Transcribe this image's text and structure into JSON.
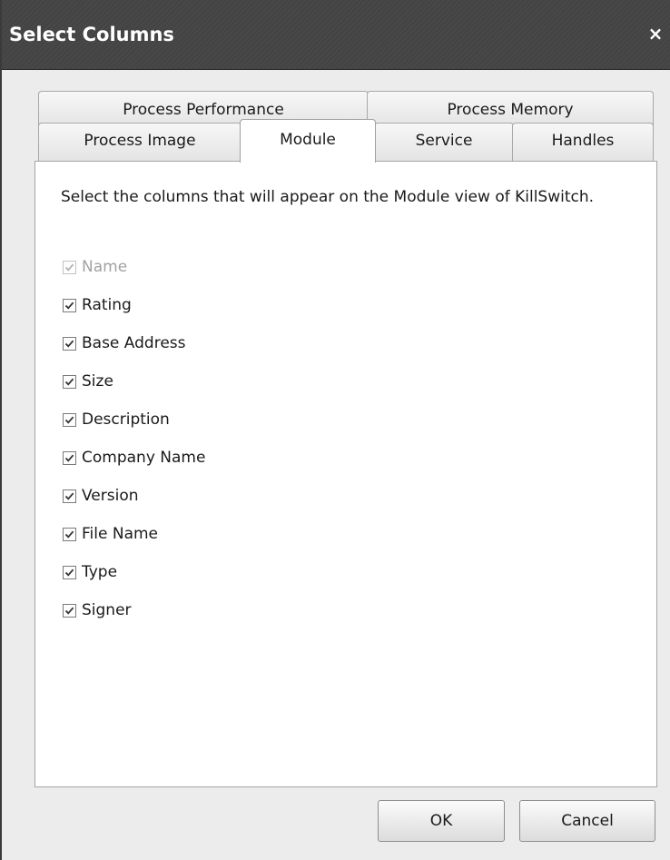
{
  "dialog": {
    "title": "Select Columns",
    "close_glyph": "×"
  },
  "tabs": {
    "row1": [
      {
        "label": "Process Performance"
      },
      {
        "label": "Process Memory"
      }
    ],
    "row2": [
      {
        "label": "Process Image"
      },
      {
        "label": "Module",
        "active": true
      },
      {
        "label": "Service"
      },
      {
        "label": "Handles"
      }
    ]
  },
  "panel": {
    "instructions": "Select the columns that will appear on the Module view of KillSwitch.",
    "columns": [
      {
        "label": "Name",
        "checked": true,
        "disabled": true
      },
      {
        "label": "Rating",
        "checked": true
      },
      {
        "label": "Base Address",
        "checked": true
      },
      {
        "label": "Size",
        "checked": true
      },
      {
        "label": "Description",
        "checked": true
      },
      {
        "label": "Company Name",
        "checked": true
      },
      {
        "label": "Version",
        "checked": true
      },
      {
        "label": "File Name",
        "checked": true
      },
      {
        "label": "Type",
        "checked": true
      },
      {
        "label": "Signer",
        "checked": true
      }
    ]
  },
  "buttons": {
    "ok": "OK",
    "cancel": "Cancel"
  },
  "colors": {
    "titlebar": "#444444",
    "check_enabled": "#333333",
    "check_disabled": "#b0b0b0"
  }
}
